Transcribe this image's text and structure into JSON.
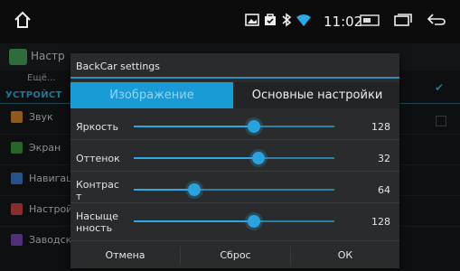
{
  "status_bar": {
    "time": "11:02",
    "icons": [
      "home-icon",
      "image-icon",
      "bag-icon",
      "bluetooth-icon",
      "wifi-icon",
      "sd-card-icon",
      "recent-apps-icon",
      "back-icon"
    ]
  },
  "settings": {
    "title": "Настр",
    "more": "Ещё...",
    "section": "УСТРОЙСТ",
    "items": [
      {
        "label": "Звук",
        "color": "#d98a2b"
      },
      {
        "label": "Экран",
        "color": "#3c9a3c"
      },
      {
        "label": "Навигац",
        "color": "#3b7fd0"
      },
      {
        "label": "Настрой",
        "color": "#d04545"
      },
      {
        "label": "Заводск",
        "color": "#7b4bb5"
      }
    ]
  },
  "dialog": {
    "title": "BackCar settings",
    "tabs": [
      {
        "label": "Изображение",
        "active": true
      },
      {
        "label": "Основные настройки",
        "active": false
      }
    ],
    "sliders": [
      {
        "label": "Яркость",
        "value": "128",
        "level": 0.6
      },
      {
        "label": "Оттенок",
        "value": "32",
        "level": 0.62
      },
      {
        "label": "Контрас т",
        "value": "64",
        "level": 0.3
      },
      {
        "label": "Насыще нность",
        "value": "128",
        "level": 0.6
      }
    ],
    "buttons": {
      "cancel": "Отмена",
      "reset": "Сброс",
      "ok": "ОК"
    }
  },
  "colors": {
    "accent": "#2aa9e6",
    "tab_active": "#199bd6"
  }
}
